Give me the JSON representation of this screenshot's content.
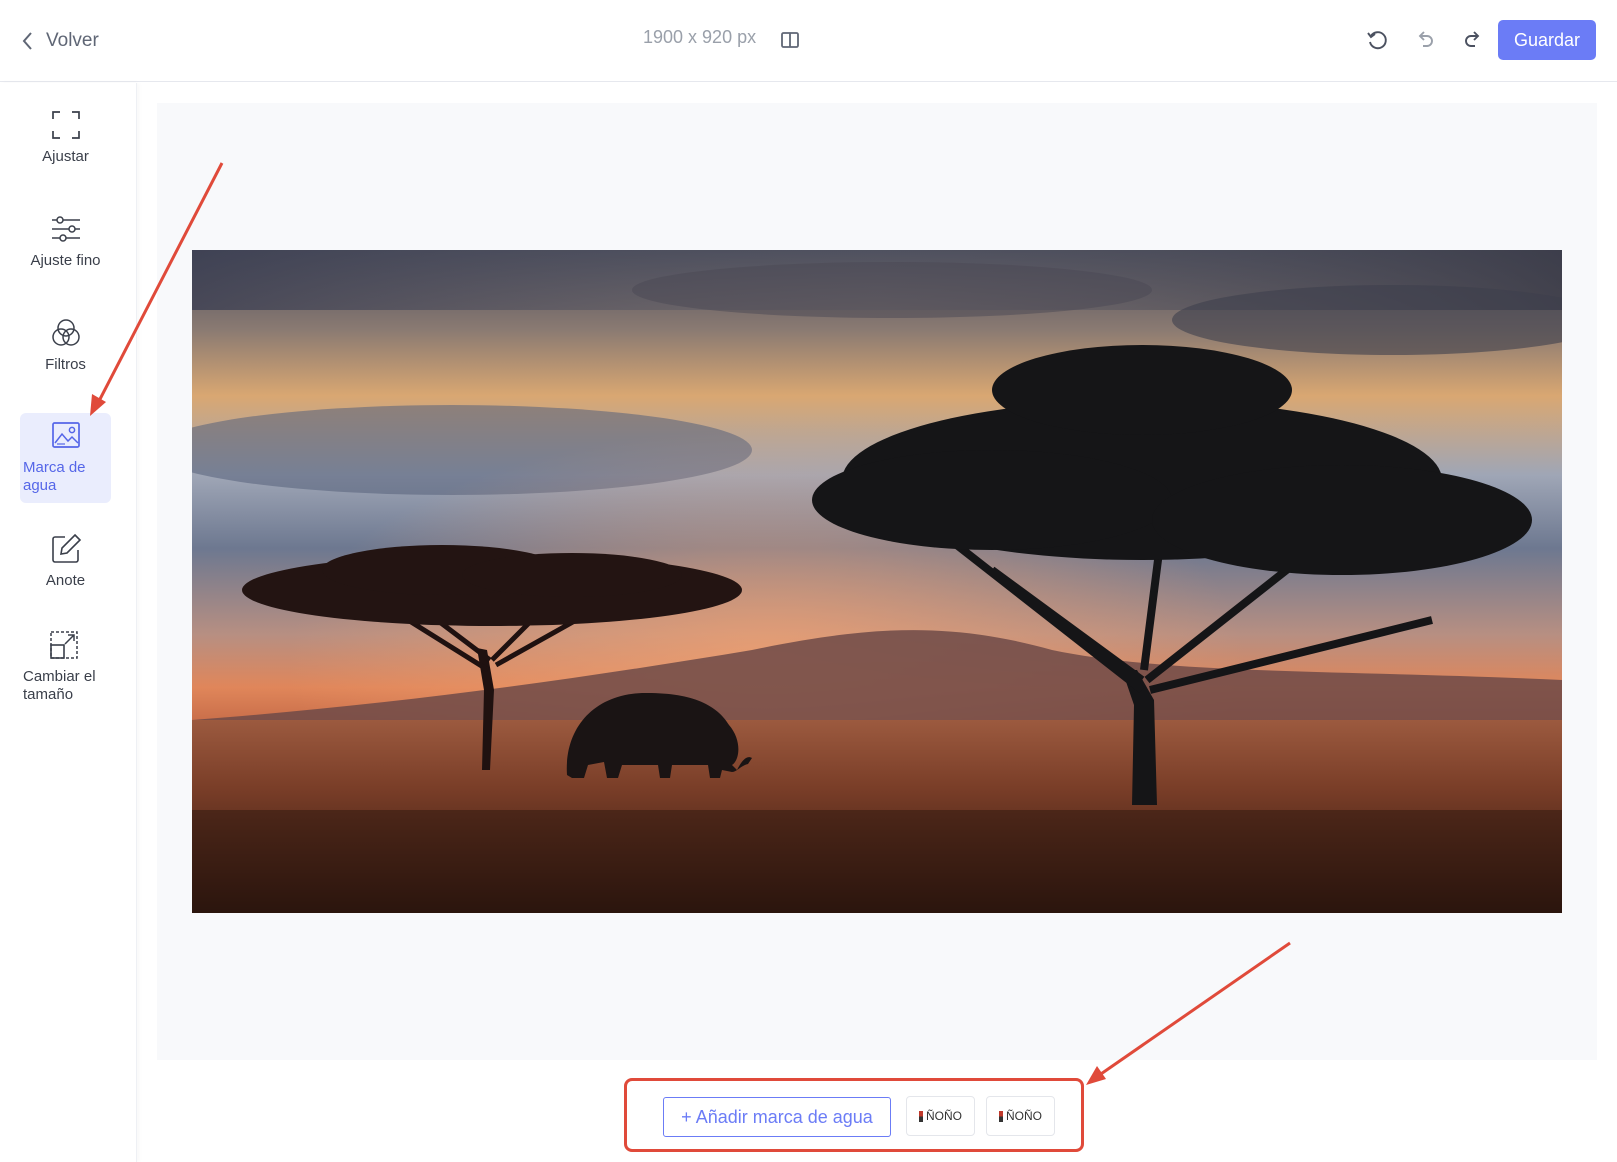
{
  "header": {
    "back_label": "Volver",
    "dimensions": "1900 x 920 px",
    "save_label": "Guardar"
  },
  "sidebar": {
    "items": [
      {
        "label": "Ajustar",
        "icon": "crop-frame-icon"
      },
      {
        "label": "Ajuste fino",
        "icon": "sliders-icon"
      },
      {
        "label": "Filtros",
        "icon": "filters-circles-icon"
      },
      {
        "label": "Marca de agua",
        "icon": "watermark-image-icon",
        "active": true
      },
      {
        "label": "Anote",
        "icon": "edit-pencil-icon"
      },
      {
        "label": "Cambiar el tamaño",
        "icon": "resize-icon"
      }
    ]
  },
  "watermark_bar": {
    "add_label": "+ Añadir marca de agua",
    "presets": [
      {
        "text": "ÑOÑO"
      },
      {
        "text": "ÑOÑO"
      }
    ]
  },
  "colors": {
    "accent": "#6b7cf6",
    "annotation": "#e04a3a",
    "active_bg": "#eaedfd"
  }
}
